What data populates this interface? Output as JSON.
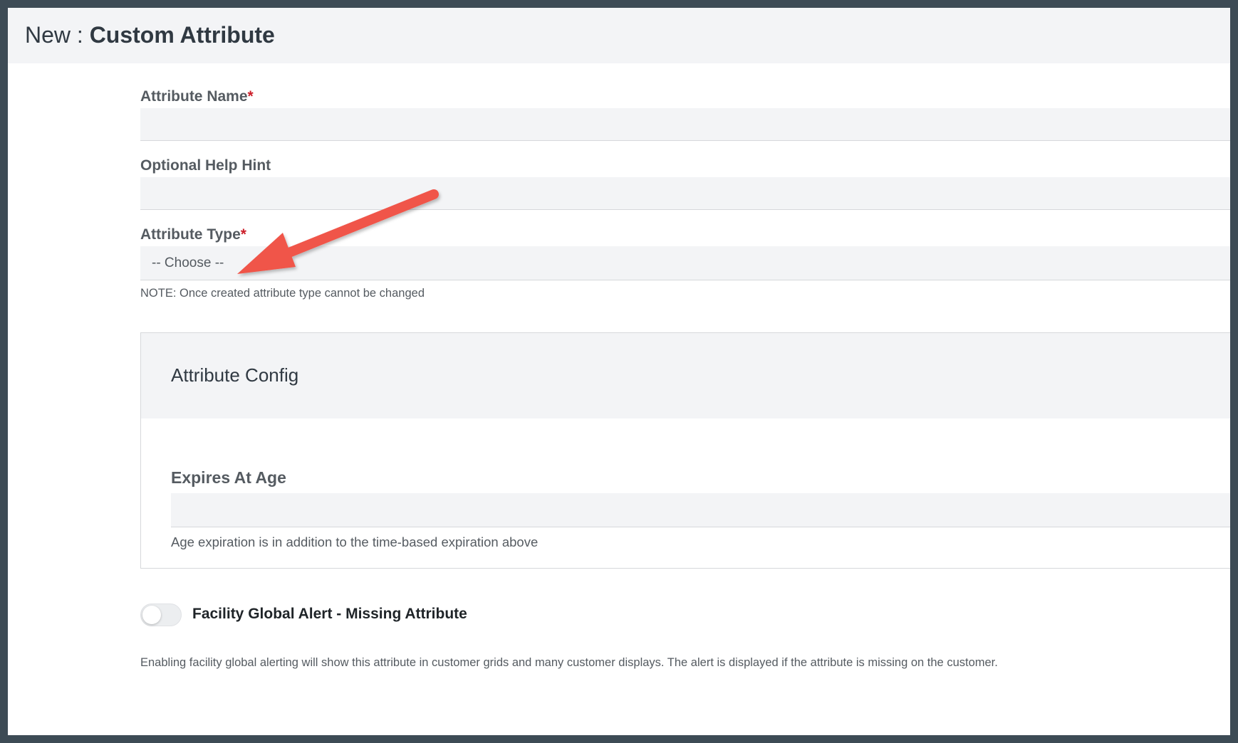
{
  "header": {
    "title_prefix": "New : ",
    "title_strong": "Custom Attribute"
  },
  "form": {
    "attribute_name": {
      "label": "Attribute Name",
      "required_mark": "*",
      "value": ""
    },
    "help_hint": {
      "label": "Optional Help Hint",
      "value": ""
    },
    "attribute_type": {
      "label": "Attribute Type",
      "required_mark": "*",
      "selected": "-- Choose --",
      "note": "NOTE: Once created attribute type cannot be changed"
    }
  },
  "config": {
    "title": "Attribute Config",
    "expires_at_age": {
      "label": "Expires At Age",
      "value": "",
      "help": "Age expiration is in addition to the time-based expiration above"
    }
  },
  "global_alert": {
    "label": "Facility Global Alert - Missing Attribute",
    "enabled": false,
    "description": "Enabling facility global alerting will show this attribute in customer grids and many customer displays. The alert is displayed if the attribute is missing on the customer."
  },
  "annotation": {
    "arrow_color": "#f0554a"
  },
  "colors": {
    "outer_background": "#3d4b55",
    "header_background": "#f3f4f6",
    "required_mark": "#cc1f2a"
  }
}
